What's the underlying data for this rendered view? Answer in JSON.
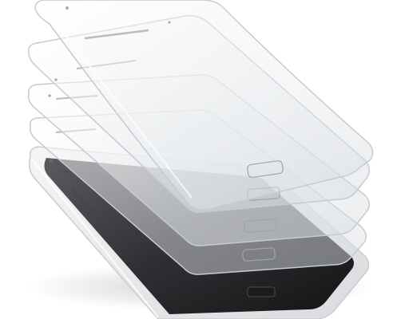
{
  "scene": {
    "subject": "smartphone-with-stacked-screen-protector-layers",
    "layer_count": 4,
    "background_color": "#ffffff",
    "colors": {
      "device_body": "#e9eaec",
      "device_rim": "#cfd1d4",
      "display": "#2b2b2d",
      "glass_fill": "#eef1f3",
      "glass_edge": "#c6cbd0"
    },
    "icons": [
      "home-button-icon",
      "speaker-slot-icon",
      "front-camera-icon"
    ]
  }
}
